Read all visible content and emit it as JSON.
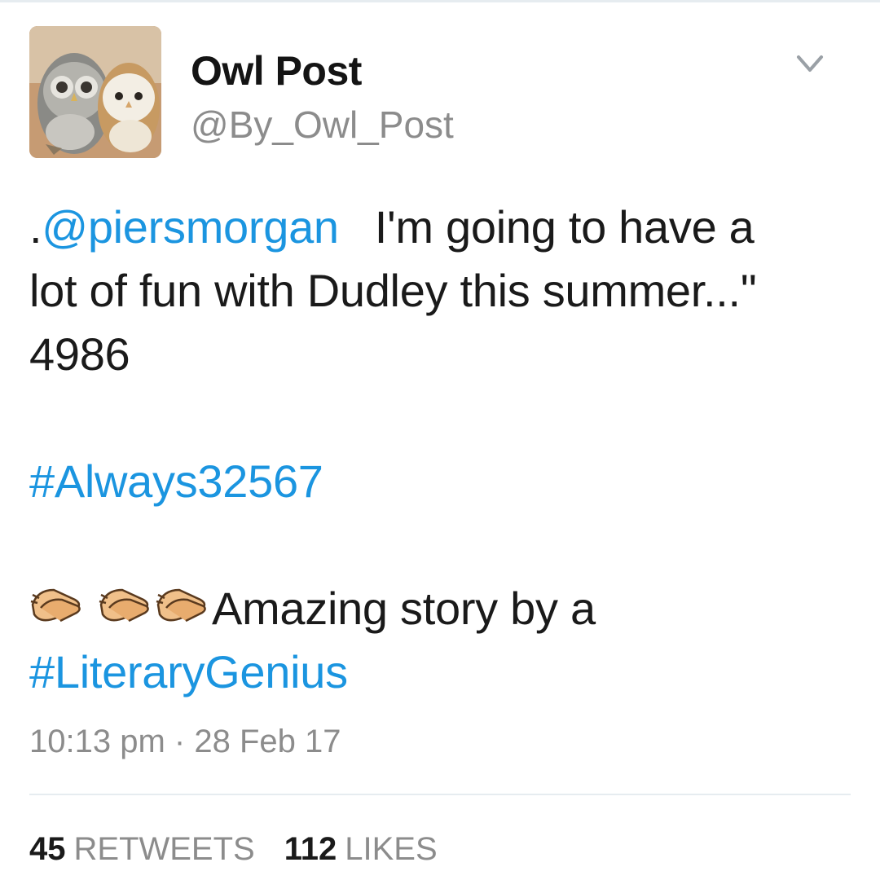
{
  "profile": {
    "display_name": "Owl Post",
    "handle": "@By_Owl_Post",
    "menu_icon": "chevron-down-icon"
  },
  "tweet": {
    "lines": [
      {
        "prefix": ".",
        "mention": "@piersmorgan",
        "text": "I'm going to have a"
      },
      {
        "text": "lot of fun with Dudley this summer...\""
      },
      {
        "text": "4986"
      },
      {
        "hashtag": "#Always32567"
      },
      {
        "clap_icons": [
          "clapping-hands-icon",
          "clapping-hands-icon",
          "clapping-hands-icon"
        ],
        "text": "Amazing story by a"
      },
      {
        "hashtag": "#LiteraryGenius"
      }
    ],
    "link_color": "#1b95e0"
  },
  "meta": {
    "time": "10:13 pm",
    "separator": "·",
    "date": "28 Feb 17"
  },
  "stats": {
    "retweets": {
      "count": "45",
      "label": "RETWEETS"
    },
    "likes": {
      "count": "112",
      "label": "LIKES"
    }
  }
}
